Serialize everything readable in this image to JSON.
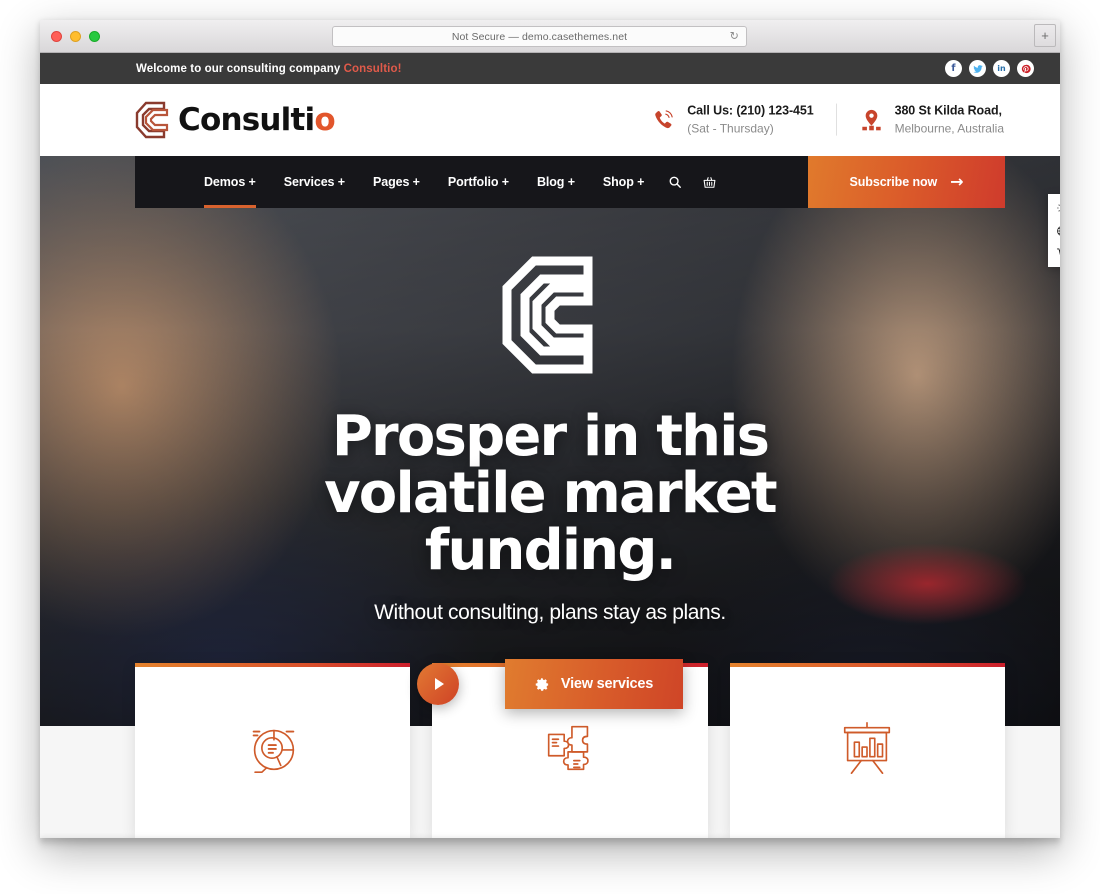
{
  "browser": {
    "url_text": "Not Secure — demo.casethemes.net",
    "reload_icon": "reload-icon",
    "new_tab_label": "+",
    "traffic_lights": [
      "close",
      "minimize",
      "maximize"
    ]
  },
  "topbar": {
    "welcome_text": "Welcome to our consulting company ",
    "brand_text": "Consultio!",
    "social": [
      {
        "name": "facebook",
        "glyph": "f",
        "color": "#3b5998"
      },
      {
        "name": "twitter",
        "glyph": "🐦",
        "color": "#4eb2ef"
      },
      {
        "name": "linkedin",
        "glyph": "in",
        "color": "#2a6fa8"
      },
      {
        "name": "pinterest",
        "glyph": "P",
        "color": "#cb2027"
      }
    ]
  },
  "header": {
    "logo_text_main": "Consulti",
    "logo_text_accent": "o",
    "contacts": [
      {
        "icon": "phone-icon",
        "line1": "Call Us: (210) 123-451",
        "line2": "(Sat - Thursday)"
      },
      {
        "icon": "location-pin-icon",
        "line1": "380 St Kilda Road,",
        "line2": "Melbourne, Australia"
      }
    ]
  },
  "nav": {
    "items": [
      {
        "label": "Demos +",
        "active": true
      },
      {
        "label": "Services +",
        "active": false
      },
      {
        "label": "Pages +",
        "active": false
      },
      {
        "label": "Portfolio +",
        "active": false
      },
      {
        "label": "Blog +",
        "active": false
      },
      {
        "label": "Shop +",
        "active": false
      }
    ],
    "search_icon": "search-icon",
    "cart_icon": "basket-icon",
    "subscribe_label": "Subscribe now",
    "subscribe_arrow": "→"
  },
  "tool_panel": {
    "buttons": [
      {
        "name": "settings-gear-icon"
      },
      {
        "name": "globe-icon"
      },
      {
        "name": "cart-icon"
      }
    ]
  },
  "hero": {
    "logo_icon": "consultio-hex-c-logo",
    "title": "Prosper in this volatile market funding.",
    "subtitle": "Without consulting, plans stay as plans.",
    "play_button_label": "play",
    "services_button_label": "View services",
    "services_button_icon": "gear-icon"
  },
  "cards": [
    {
      "icon": "pie-chart-icon"
    },
    {
      "icon": "puzzle-pieces-icon"
    },
    {
      "icon": "presentation-chart-icon"
    }
  ],
  "colors": {
    "accent_orange": "#d8622e",
    "accent_red": "#cc1f2c",
    "topbar_bg": "#3a3a3a",
    "nav_bg": "#16161a"
  }
}
